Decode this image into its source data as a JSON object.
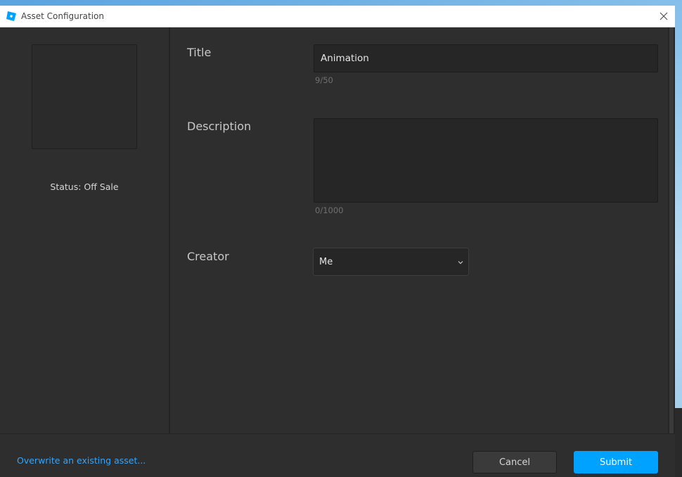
{
  "window": {
    "title": "Asset Configuration",
    "app_icon": "roblox-studio-icon",
    "close_icon": "close-icon"
  },
  "left_panel": {
    "status": "Status: Off Sale"
  },
  "form": {
    "title_label": "Title",
    "title_value": "Animation",
    "title_counter": "9/50",
    "description_label": "Description",
    "description_value": "",
    "description_counter": "0/1000",
    "creator_label": "Creator",
    "creator_value": "Me"
  },
  "footer": {
    "overwrite_link": "Overwrite an existing asset...",
    "cancel_label": "Cancel",
    "submit_label": "Submit"
  },
  "colors": {
    "accent": "#00a2ff",
    "link": "#3aa3f5",
    "background": "#2e2e2e"
  }
}
